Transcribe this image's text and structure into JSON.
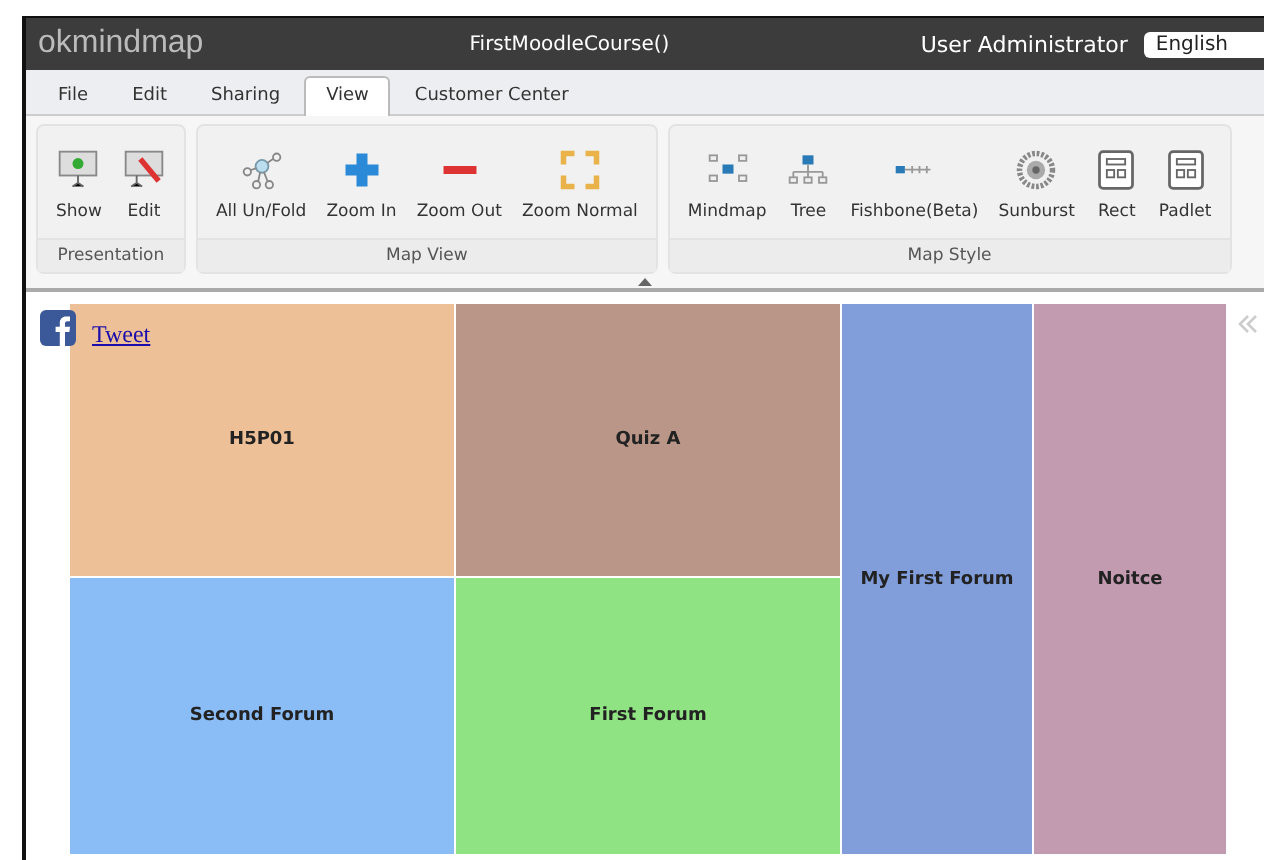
{
  "header": {
    "logo": "okmindmap",
    "title": "FirstMoodleCourse()",
    "user": "User Administrator",
    "language": "English"
  },
  "tabs": [
    {
      "label": "File",
      "selected": false
    },
    {
      "label": "Edit",
      "selected": false
    },
    {
      "label": "Sharing",
      "selected": false
    },
    {
      "label": "View",
      "selected": true
    },
    {
      "label": "Customer Center",
      "selected": false
    }
  ],
  "ribbon": [
    {
      "label": "Presentation",
      "buttons": [
        {
          "label": "Show",
          "kind": "show"
        },
        {
          "label": "Edit",
          "kind": "edit"
        }
      ]
    },
    {
      "label": "Map View",
      "buttons": [
        {
          "label": "All Un/Fold",
          "kind": "fold"
        },
        {
          "label": "Zoom In",
          "kind": "zoomin"
        },
        {
          "label": "Zoom Out",
          "kind": "zoomout"
        },
        {
          "label": "Zoom Normal",
          "kind": "normal"
        }
      ]
    },
    {
      "label": "Map Style",
      "buttons": [
        {
          "label": "Mindmap",
          "kind": "mindmap"
        },
        {
          "label": "Tree",
          "kind": "tree"
        },
        {
          "label": "Fishbone(Beta)",
          "kind": "fishbone"
        },
        {
          "label": "Sunburst",
          "kind": "sunburst"
        },
        {
          "label": "Rect",
          "kind": "rect"
        },
        {
          "label": "Padlet",
          "kind": "rect"
        }
      ]
    }
  ],
  "share": {
    "link": "Tweet"
  },
  "treemap": [
    {
      "label": "H5P01",
      "color": "#eec097"
    },
    {
      "label": "Quiz A",
      "color": "#b99687"
    },
    {
      "label": "My First Forum",
      "color": "#819dda"
    },
    {
      "label": "Noitce",
      "color": "#c29bb1"
    },
    {
      "label": "Second Forum",
      "color": "#8abcf6"
    },
    {
      "label": "First Forum",
      "color": "#90e383"
    }
  ]
}
